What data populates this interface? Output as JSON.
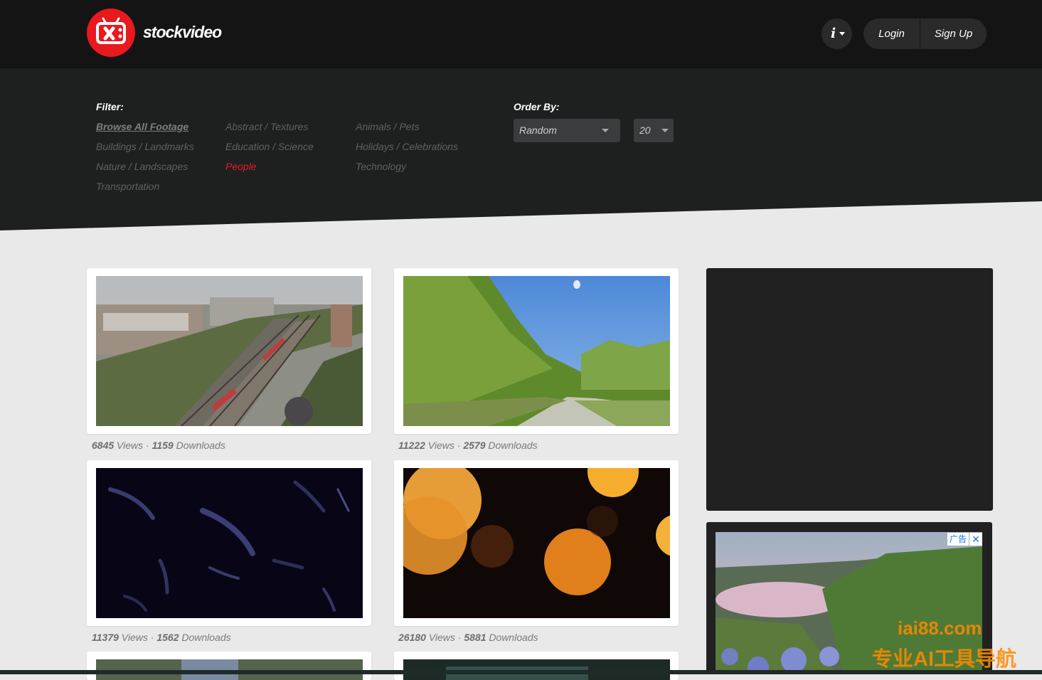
{
  "brand": {
    "name": "stockvideo",
    "accent": "#e8191f"
  },
  "header": {
    "info_icon": "info-icon",
    "login_label": "Login",
    "signup_label": "Sign Up"
  },
  "filter": {
    "label": "Filter:",
    "columns": [
      [
        "Browse All Footage",
        "Buildings / Landmarks",
        "Nature / Landscapes",
        "Transportation"
      ],
      [
        "Abstract / Textures",
        "Education / Science",
        "People"
      ],
      [
        "Animals / Pets",
        "Holidays / Celebrations",
        "Technology"
      ]
    ],
    "active": "Browse All Footage",
    "current": "People"
  },
  "order": {
    "label": "Order By:",
    "sort_value": "Random",
    "count_value": "20"
  },
  "videos": [
    {
      "views": "6845",
      "views_label": "Views",
      "downloads": "1159",
      "downloads_label": "Downloads",
      "thumb": "aerial-rail-yard"
    },
    {
      "views": "11222",
      "views_label": "Views",
      "downloads": "2579",
      "downloads_label": "Downloads",
      "thumb": "country-road-motion"
    },
    {
      "views": "11379",
      "views_label": "Views",
      "downloads": "1562",
      "downloads_label": "Downloads",
      "thumb": "dark-particles"
    },
    {
      "views": "26180",
      "views_label": "Views",
      "downloads": "5881",
      "downloads_label": "Downloads",
      "thumb": "orange-bokeh"
    }
  ],
  "ad": {
    "tag": "广告",
    "close": "✕"
  },
  "watermark": {
    "line1": "iai88.com",
    "line2": "专业AI工具导航"
  }
}
